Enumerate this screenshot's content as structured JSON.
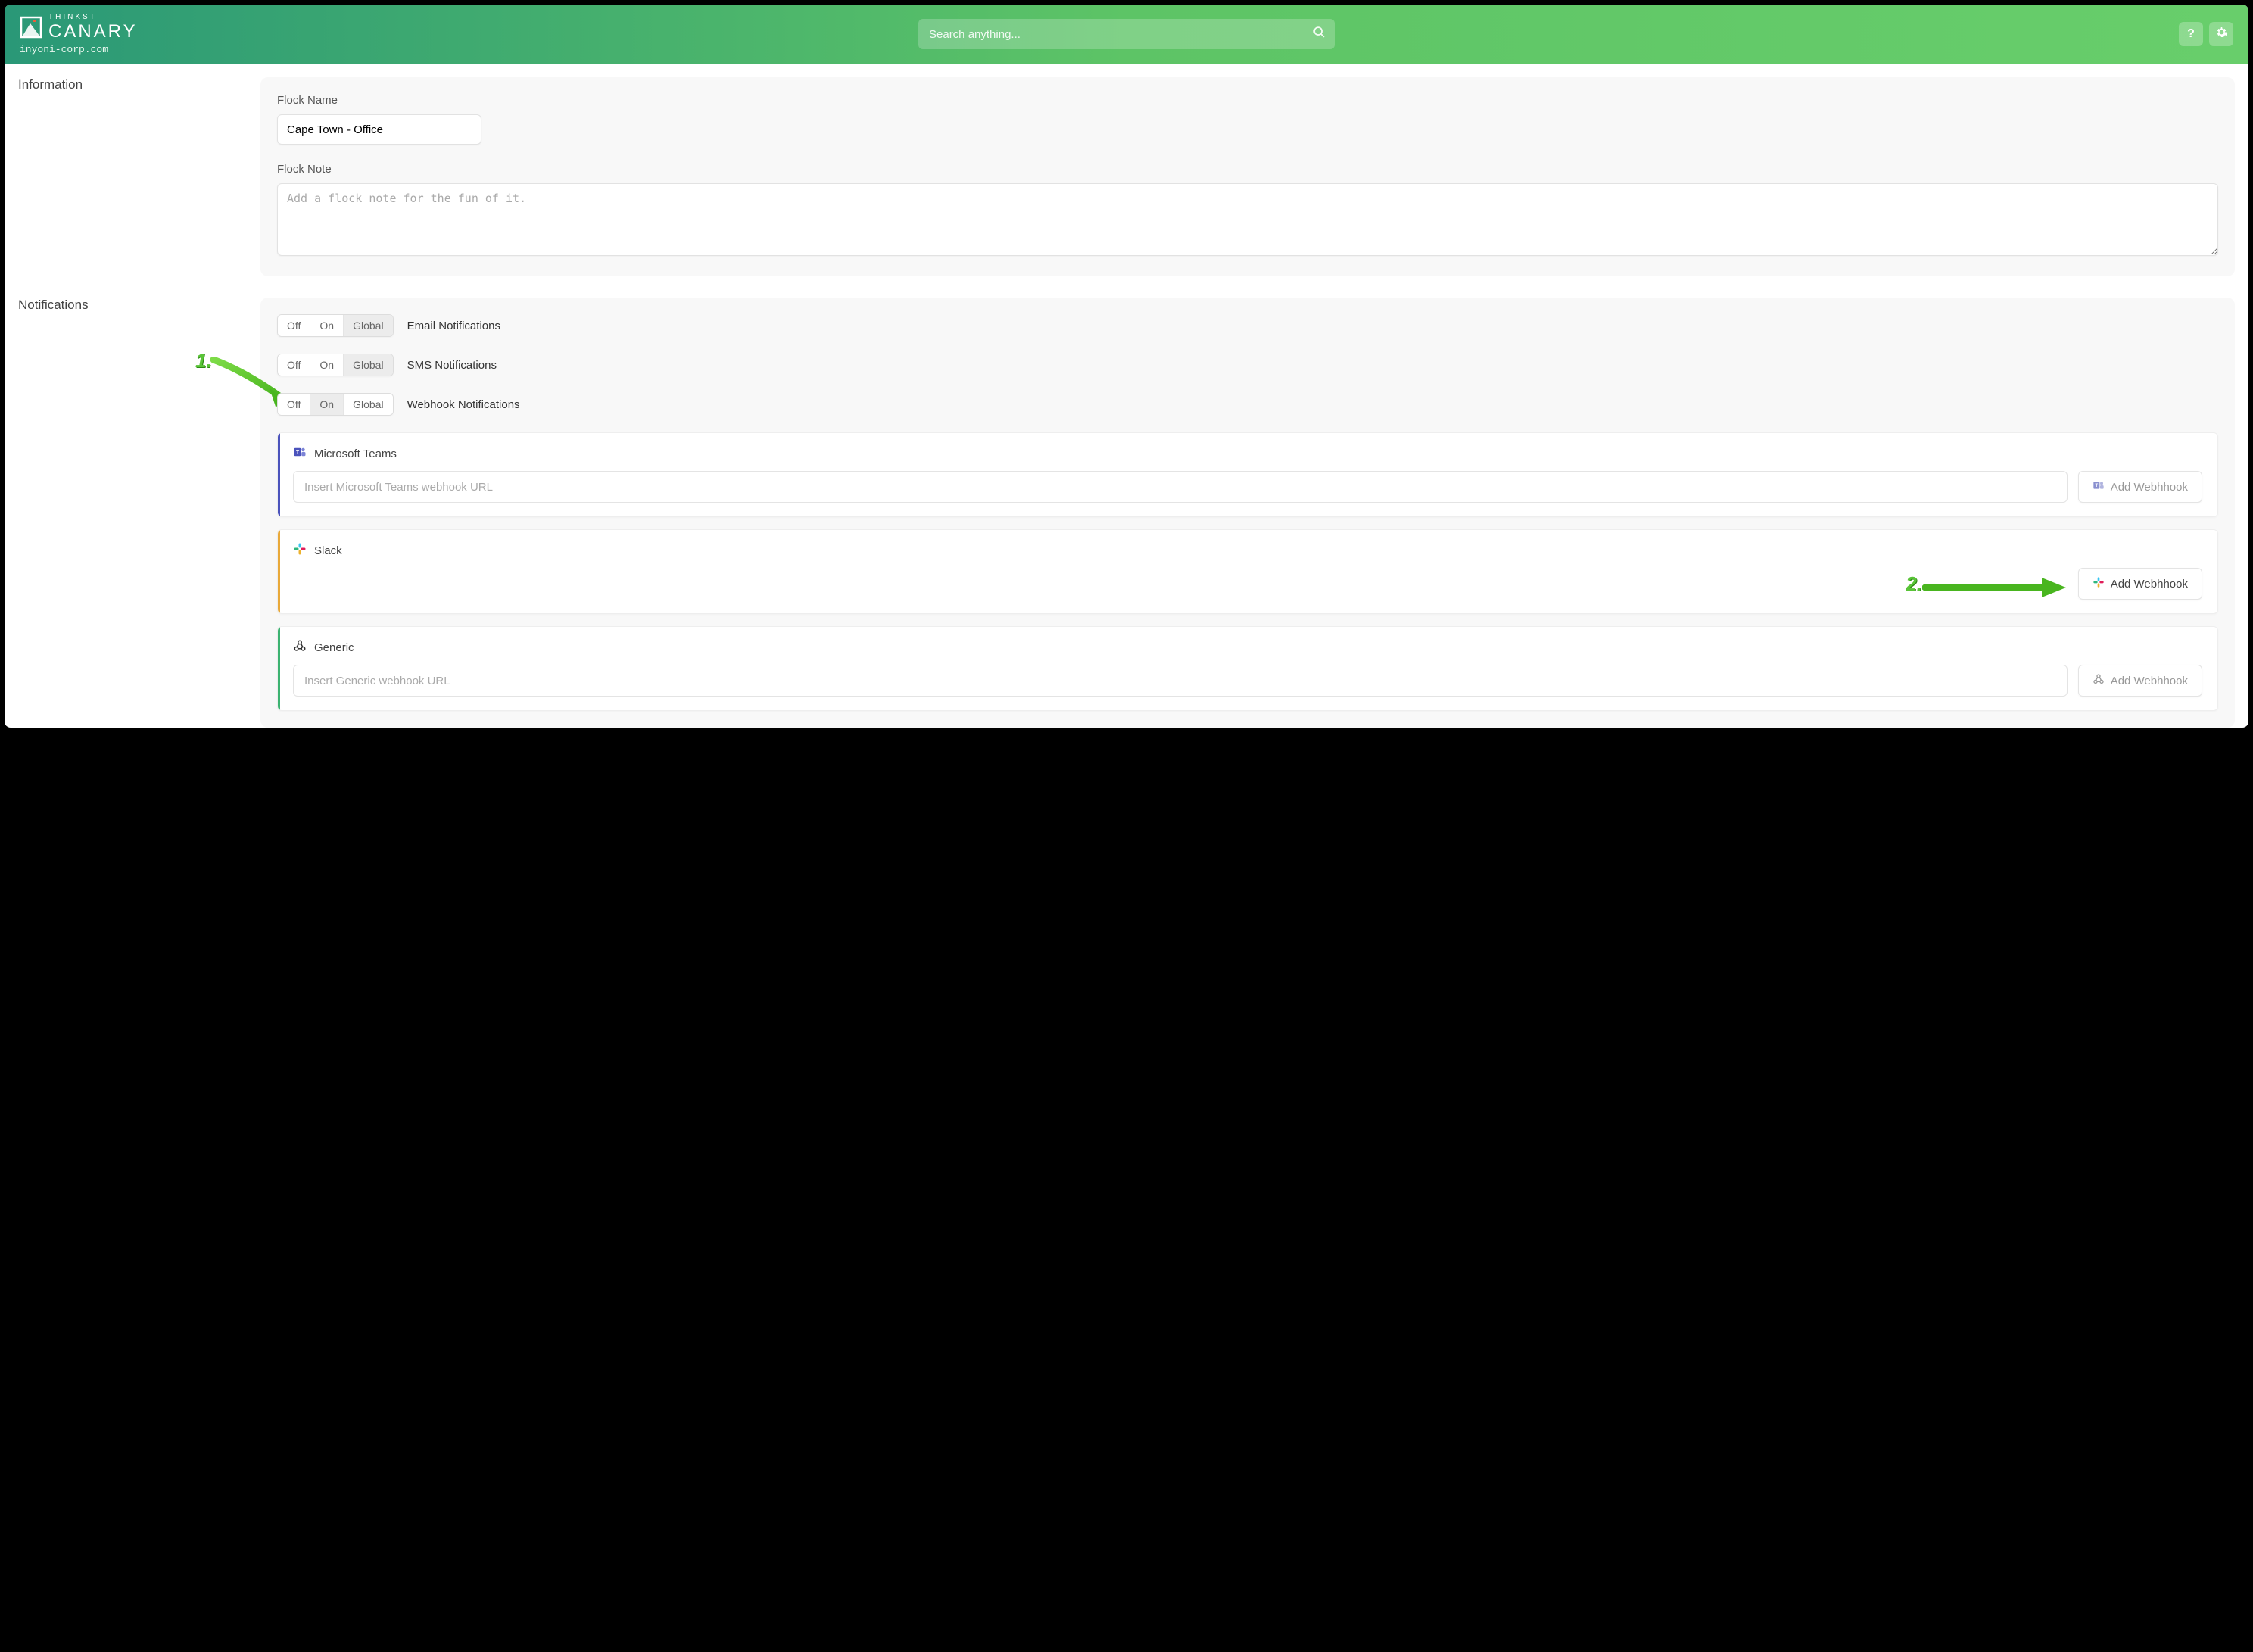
{
  "brand": {
    "small": "THINKST",
    "big": "CANARY",
    "domain": "inyoni-corp.com"
  },
  "search": {
    "placeholder": "Search anything..."
  },
  "sections": {
    "information": "Information",
    "notifications": "Notifications"
  },
  "info": {
    "flock_name_label": "Flock Name",
    "flock_name_value": "Cape Town - Office",
    "flock_note_label": "Flock Note",
    "flock_note_placeholder": "Add a flock note for the fun of it."
  },
  "seg": {
    "off": "Off",
    "on": "On",
    "global": "Global"
  },
  "notifs": {
    "email": {
      "label": "Email Notifications",
      "active": "global"
    },
    "sms": {
      "label": "SMS Notifications",
      "active": "global"
    },
    "webhook": {
      "label": "Webhook Notifications",
      "active": "on"
    }
  },
  "webhooks": {
    "teams": {
      "title": "Microsoft Teams",
      "placeholder": "Insert Microsoft Teams webhook URL",
      "button": "Add Webhhook",
      "stripe": "#4b53bc"
    },
    "slack": {
      "title": "Slack",
      "button": "Add Webhhook",
      "stripe": "#e9a93a"
    },
    "generic": {
      "title": "Generic",
      "placeholder": "Insert Generic webhook URL",
      "button": "Add Webhhook",
      "stripe": "#3cb371"
    }
  },
  "annotations": {
    "one": "1.",
    "two": "2."
  }
}
